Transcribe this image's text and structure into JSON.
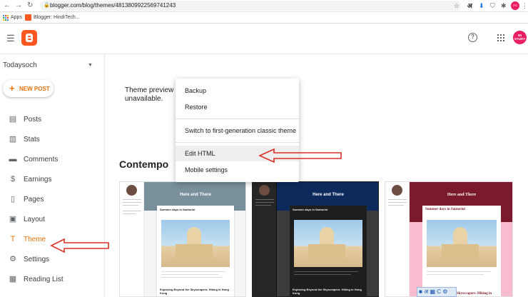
{
  "browser": {
    "url": "blogger.com/blog/themes/4813809922569741243",
    "bookmarks": [
      {
        "label": "Apps"
      },
      {
        "label": "Blogger: HindiTech..."
      }
    ],
    "hindi_char": "अ",
    "profile_avatar_text": "PS"
  },
  "header": {
    "help_glyph": "?",
    "avatar_text": "90 STUDY"
  },
  "sidebar": {
    "blog_name": "Todaysoch",
    "new_post_label": "NEW POST",
    "items": [
      {
        "label": "Posts",
        "icon": "posts-icon"
      },
      {
        "label": "Stats",
        "icon": "stats-icon"
      },
      {
        "label": "Comments",
        "icon": "comments-icon"
      },
      {
        "label": "Earnings",
        "icon": "earnings-icon"
      },
      {
        "label": "Pages",
        "icon": "pages-icon"
      },
      {
        "label": "Layout",
        "icon": "layout-icon"
      },
      {
        "label": "Theme",
        "icon": "theme-icon",
        "active": true
      },
      {
        "label": "Settings",
        "icon": "settings-icon"
      },
      {
        "label": "Reading List",
        "icon": "reading-list-icon"
      }
    ]
  },
  "main": {
    "preview_message_start": "Theme preview is c",
    "preview_message_end": "unavailable.",
    "theme_name": "Contempo"
  },
  "menu": {
    "items": [
      "Backup",
      "Restore",
      "Switch to first-generation classic theme",
      "Edit HTML",
      "Mobile settings"
    ]
  },
  "previews": [
    {
      "title": "Here and There",
      "post_title": "Summer days in Santorini",
      "footer": "Exploring Beyond the Skyscrapers: Hiking in Hong Kong"
    },
    {
      "title": "Here and There",
      "post_title": "Summer days in Santorini",
      "footer": "Exploring Beyond the Skyscrapers: Hiking in Hong Kong"
    },
    {
      "title": "Here and There",
      "post_title": "Summer days in Santorini",
      "footer": "Skyscrapers: Hiking in"
    }
  ],
  "colors": {
    "accent": "#e8710a",
    "annotation_arrow": "#d93025",
    "blogger_logo": "#ff5722",
    "avatar": "#e91e63"
  }
}
